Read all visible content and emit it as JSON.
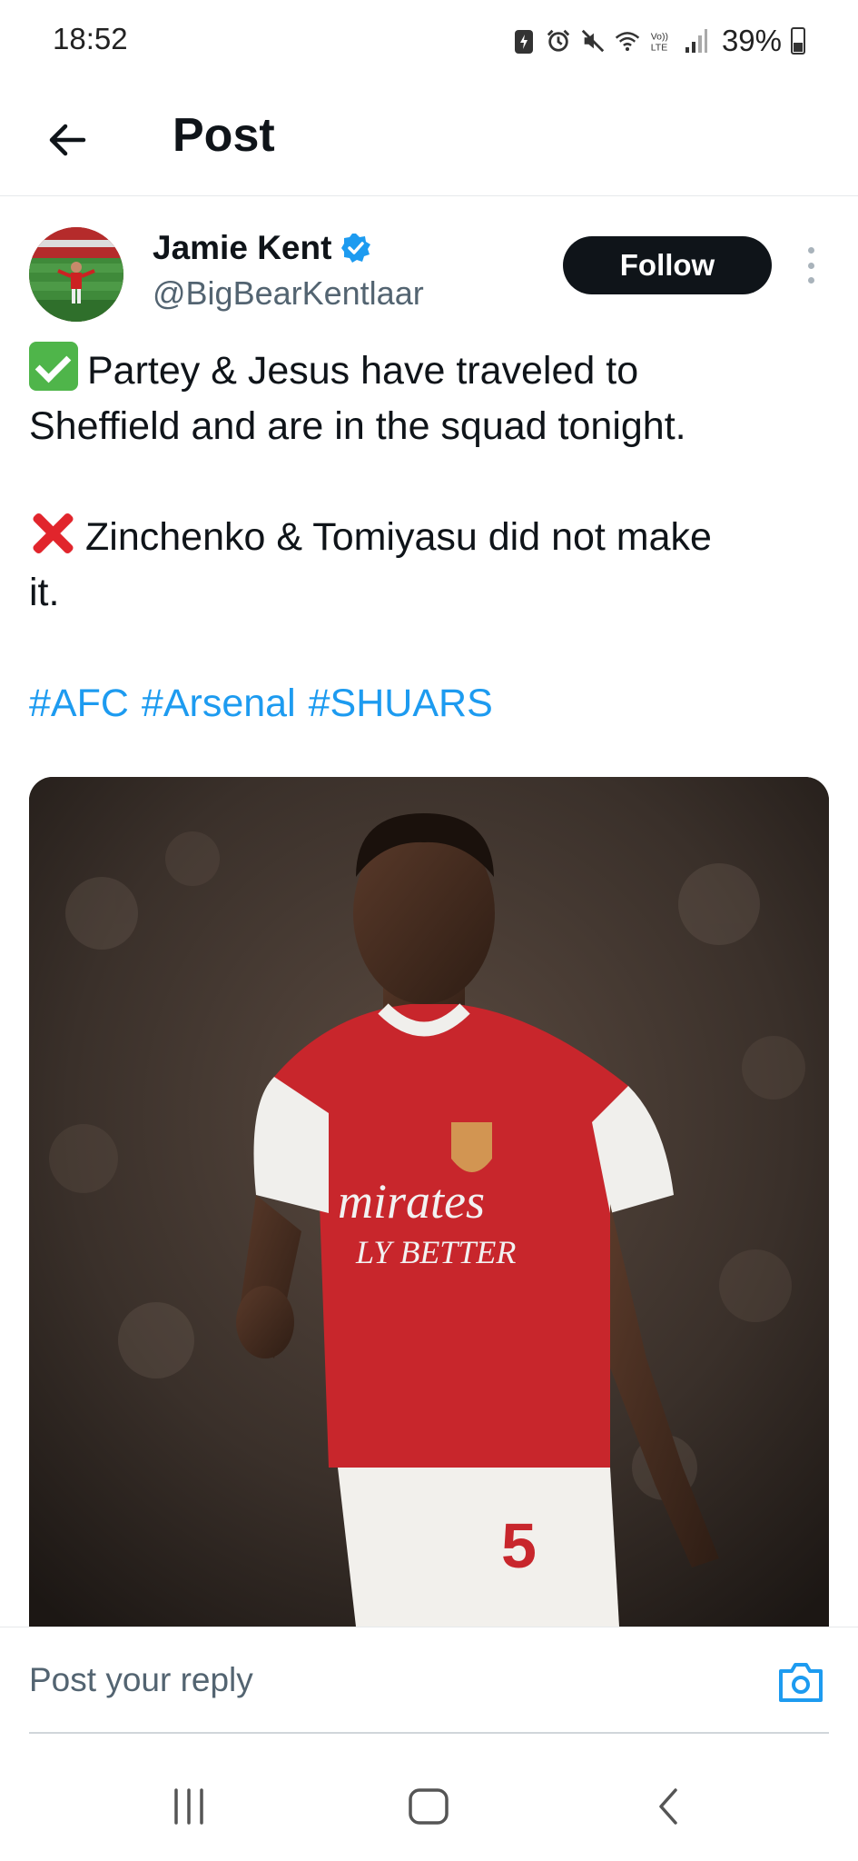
{
  "status_bar": {
    "time": "18:52",
    "battery": "39%",
    "icons": [
      "battery-saver-icon",
      "alarm-icon",
      "mute-icon",
      "wifi-icon",
      "volte-icon",
      "signal-icon",
      "battery-icon"
    ]
  },
  "header": {
    "title": "Post",
    "back_icon": "arrow-left-icon"
  },
  "author": {
    "name": "Jamie Kent",
    "handle": "@BigBearKentlaar",
    "verified": true,
    "follow_label": "Follow"
  },
  "tweet": {
    "line1": "Partey & Jesus have traveled to",
    "line2": "Sheffield and are in the squad tonight.",
    "line3": "Zinchenko & Tomiyasu did not make",
    "line4": "it.",
    "hashtags": [
      "#AFC",
      "#Arsenal",
      "#SHUARS"
    ],
    "media_shirt_text_1": "mirates",
    "media_shirt_text_2": "LY BETTER",
    "media_shirt_number": "5"
  },
  "reply": {
    "placeholder": "Post your reply"
  },
  "colors": {
    "accent": "#1d9bf0",
    "text": "#0f1419",
    "muted": "#536471",
    "follow_bg": "#0f1419"
  },
  "nav": {
    "recents_icon": "recents-icon",
    "home_icon": "home-icon",
    "back_icon": "back-chevron-icon"
  }
}
